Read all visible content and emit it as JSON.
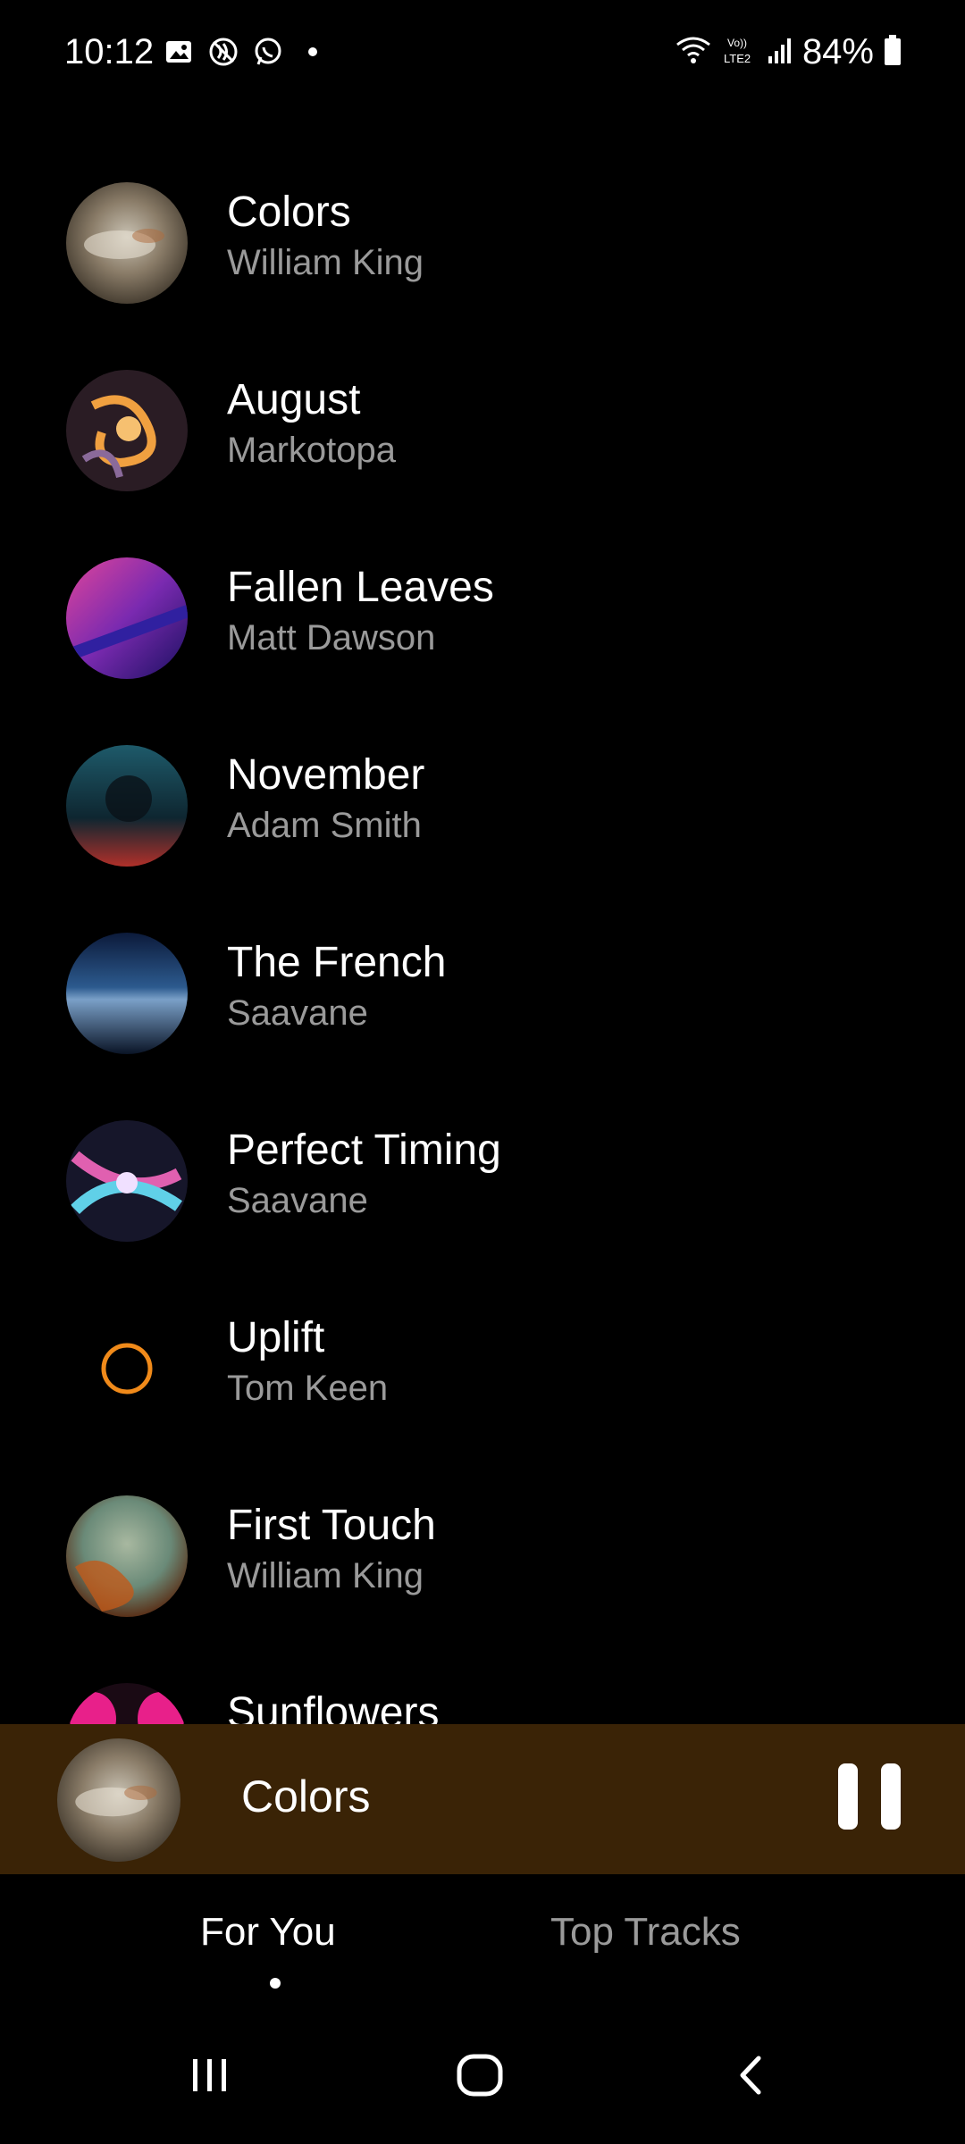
{
  "status_bar": {
    "time": "10:12",
    "battery": "84%",
    "left_icons": [
      "gallery-icon",
      "no-nfc-icon",
      "whatsapp-icon",
      "dot-icon"
    ],
    "right_icons": [
      "wifi-icon",
      "volte-lte2-icon",
      "signal-icon",
      "battery-icon"
    ]
  },
  "tracks": [
    {
      "title": "Colors",
      "artist": "William King",
      "art": "abstract-grey-art"
    },
    {
      "title": "August",
      "artist": "Markotopa",
      "art": "abstract-orange-swirl-art"
    },
    {
      "title": "Fallen Leaves",
      "artist": "Matt Dawson",
      "art": "abstract-purple-art"
    },
    {
      "title": "November",
      "artist": "Adam Smith",
      "art": "abstract-teal-red-art"
    },
    {
      "title": "The French",
      "artist": "Saavane",
      "art": "abstract-blue-art"
    },
    {
      "title": "Perfect Timing",
      "artist": "Saavane",
      "art": "abstract-pink-cyan-swirl-art"
    },
    {
      "title": "Uplift",
      "artist": "Tom Keen",
      "art": "orange-ring-art"
    },
    {
      "title": "First Touch",
      "artist": "William King",
      "art": "abstract-teal-orange-art"
    },
    {
      "title": "Sunflowers",
      "artist": "",
      "art": "abstract-pink-art"
    }
  ],
  "now_playing": {
    "title": "Colors",
    "art": "abstract-grey-art",
    "control": "pause-icon"
  },
  "tabs": [
    {
      "label": "For You",
      "active": true
    },
    {
      "label": "Top Tracks",
      "active": false
    }
  ],
  "nav": [
    "recents-icon",
    "home-icon",
    "back-icon"
  ],
  "colors": {
    "background": "#000000",
    "now_playing_bg": "#3a2306",
    "secondary_text": "#9a9a9a",
    "accent_ring": "#f08a1a"
  }
}
